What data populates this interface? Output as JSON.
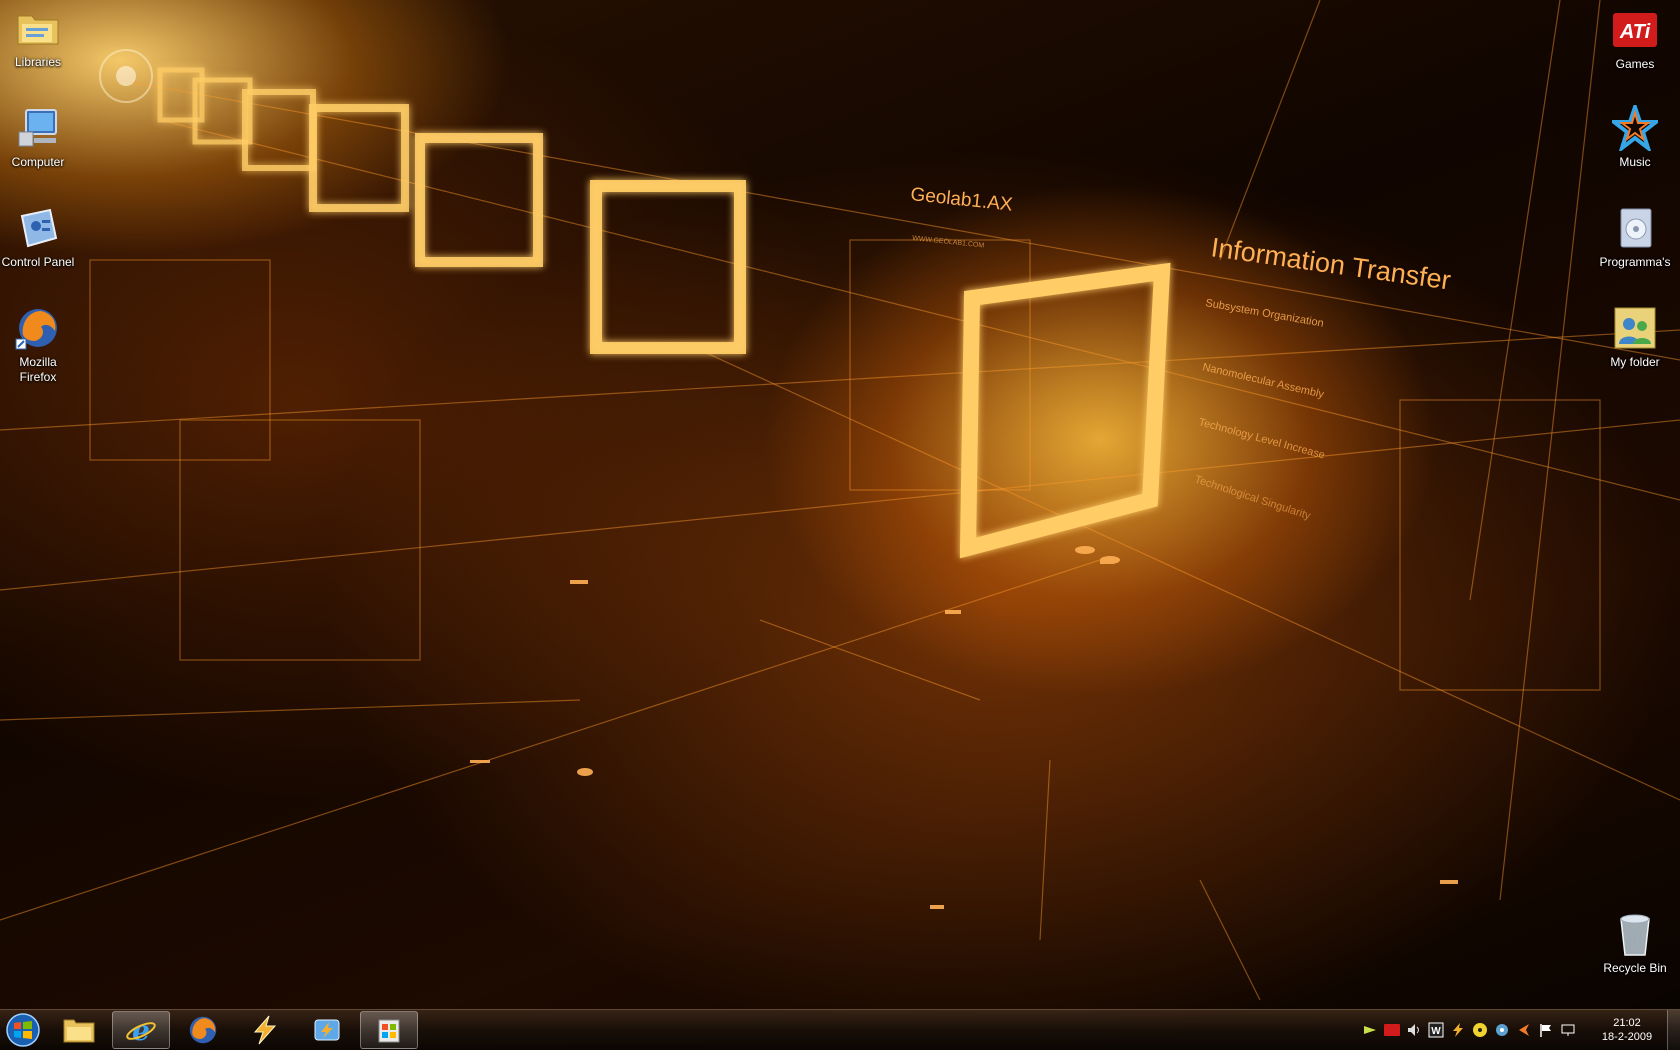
{
  "wallpaper": {
    "title": "Geolab1.AX",
    "url": "WWW.GEOLAB1.COM",
    "heading": "Information Transfer",
    "items": [
      "Subsystem Organization",
      "Nanomolecular Assembly",
      "Technology Level Increase",
      "Technological Singularity"
    ]
  },
  "desktop": {
    "left_icons": [
      {
        "label": "Libraries",
        "icon": "libraries-folder-icon"
      },
      {
        "label": "Computer",
        "icon": "computer-icon"
      },
      {
        "label": "Control Panel",
        "icon": "control-panel-icon"
      },
      {
        "label": "Mozilla\nFirefox",
        "icon": "firefox-icon"
      }
    ],
    "right_icons": [
      {
        "label": "Games",
        "icon": "ati-games-icon"
      },
      {
        "label": "Music",
        "icon": "music-star-icon"
      },
      {
        "label": "Programma's",
        "icon": "programs-icon"
      },
      {
        "label": "My folder",
        "icon": "user-folder-icon"
      }
    ],
    "recycle_bin": {
      "label": "Recycle Bin",
      "icon": "recycle-bin-icon"
    }
  },
  "taskbar": {
    "start": "start-orb-icon",
    "pinned": [
      {
        "icon": "explorer-folder-icon",
        "active": false
      },
      {
        "icon": "internet-explorer-icon",
        "active": true
      },
      {
        "icon": "firefox-icon",
        "active": false
      },
      {
        "icon": "winamp-lightning-icon",
        "active": false
      },
      {
        "icon": "windows-live-icon",
        "active": false
      },
      {
        "icon": "media-center-icon",
        "active": true
      }
    ],
    "tray": [
      "network-icon",
      "ati-icon",
      "volume-icon",
      "winrar-icon",
      "lightning-icon",
      "cd-icon",
      "speaker-icon",
      "arrow-icon",
      "flag-icon",
      "monitor-icon"
    ],
    "clock": {
      "time": "21:02",
      "date": "18-2-2009"
    }
  },
  "colors": {
    "accent": "#ff9c2a",
    "glow": "#ffd36b"
  }
}
